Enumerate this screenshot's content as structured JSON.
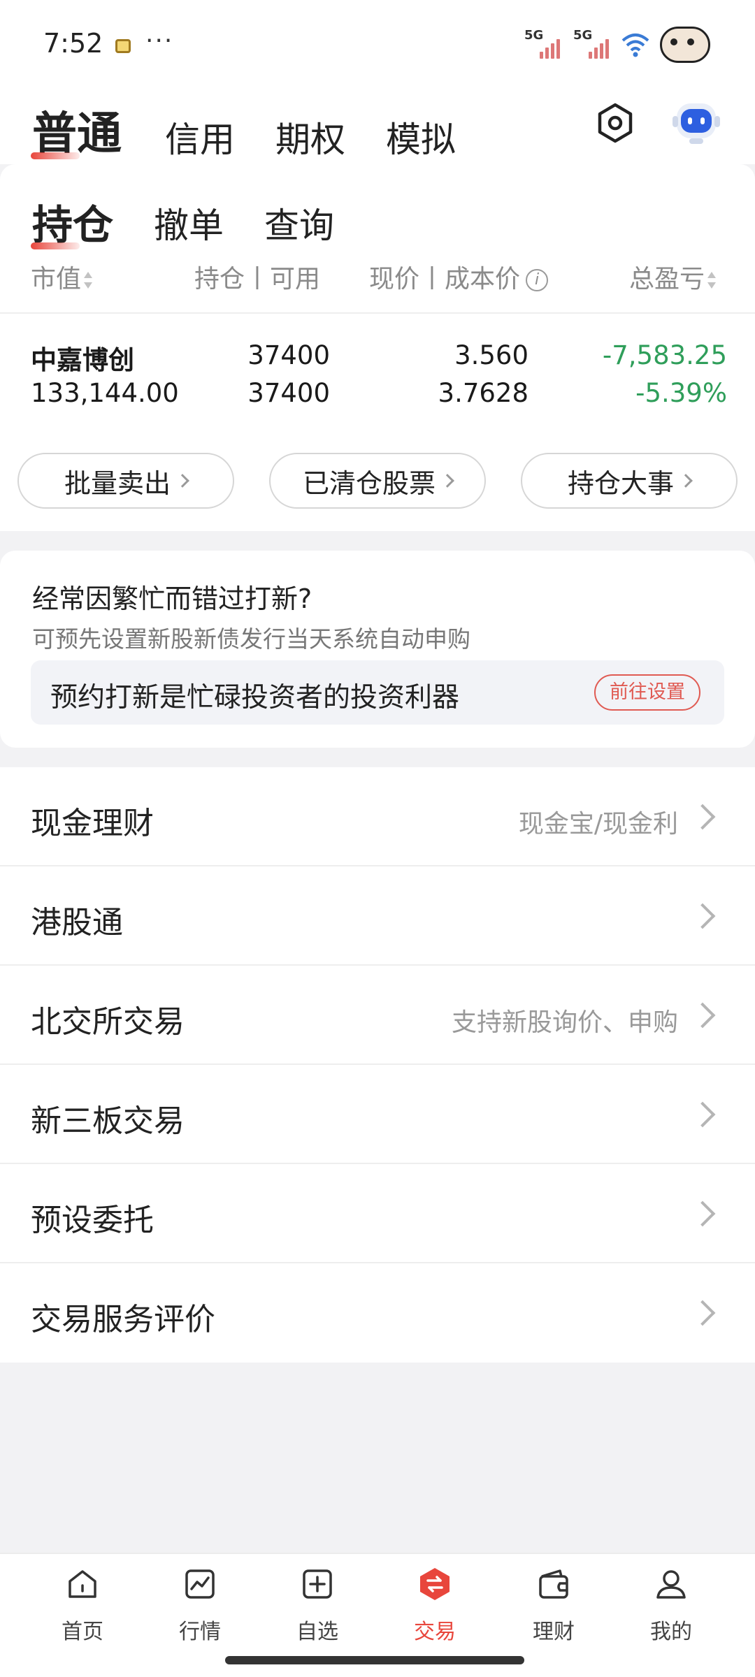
{
  "status_bar": {
    "time": "7:52",
    "more": "···",
    "signal1": "5G",
    "signal2": "5G"
  },
  "top_tabs": [
    "普通",
    "信用",
    "期权",
    "模拟"
  ],
  "sub_tabs": [
    "持仓",
    "撤单",
    "查询"
  ],
  "columns": {
    "market_value": "市值",
    "holding_available": "持仓丨可用",
    "price_cost": "现价丨成本价",
    "pnl": "总盈亏"
  },
  "holding": {
    "name": "中嘉博创",
    "market_value": "133,144.00",
    "position": "37400",
    "available": "37400",
    "current_price": "3.560",
    "cost_price": "3.7628",
    "pnl": "-7,583.25",
    "pnl_pct": "-5.39%"
  },
  "pills": [
    "批量卖出",
    "已清仓股票",
    "持仓大事"
  ],
  "promo": {
    "title": "经常因繁忙而错过打新?",
    "subtitle": "可预先设置新股新债发行当天系统自动申购",
    "banner": "预约打新是忙碌投资者的投资利器",
    "button": "前往设置"
  },
  "menu": [
    {
      "label": "现金理财",
      "hint": "现金宝/现金利"
    },
    {
      "label": "港股通",
      "hint": ""
    },
    {
      "label": "北交所交易",
      "hint": "支持新股询价、申购"
    },
    {
      "label": "新三板交易",
      "hint": ""
    },
    {
      "label": "预设委托",
      "hint": ""
    },
    {
      "label": "交易服务评价",
      "hint": ""
    }
  ],
  "bottom_nav": [
    "首页",
    "行情",
    "自选",
    "交易",
    "理财",
    "我的"
  ],
  "colors": {
    "accent": "#e8463c",
    "loss": "#2f9e5a",
    "muted": "#999999"
  }
}
